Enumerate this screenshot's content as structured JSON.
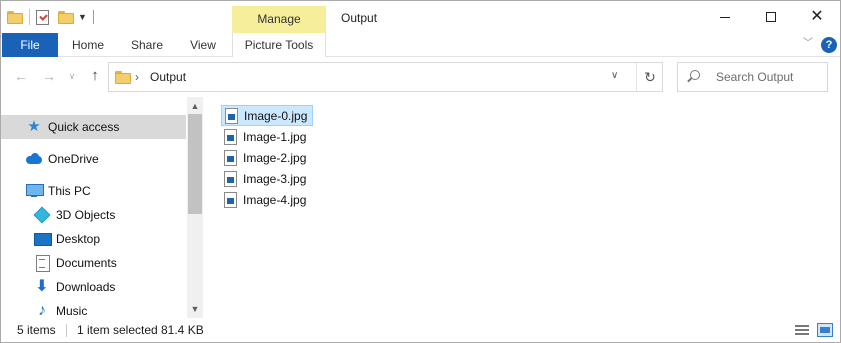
{
  "window": {
    "title": "Output",
    "contextual_tab_group": "Manage",
    "controls": [
      "minimize-icon",
      "maximize-icon",
      "close-icon"
    ]
  },
  "quick_access_toolbar": {
    "icons": [
      "folder-icon",
      "properties-icon",
      "new-folder-icon",
      "customize-dropdown-icon"
    ]
  },
  "ribbon": {
    "tabs": [
      {
        "label": "File",
        "active": true,
        "color": "#1a62b8"
      },
      {
        "label": "Home"
      },
      {
        "label": "Share"
      },
      {
        "label": "View"
      },
      {
        "label": "Picture Tools"
      }
    ],
    "help_label": "?"
  },
  "address_bar": {
    "path": "Output",
    "search_placeholder": "Search Output"
  },
  "nav_pane": {
    "items": [
      {
        "label": "Quick access",
        "icon": "star-icon",
        "selected": true
      },
      {
        "label": "OneDrive",
        "icon": "onedrive-cloud-icon"
      },
      {
        "label": "This PC",
        "icon": "computer-icon"
      },
      {
        "label": "3D Objects",
        "icon": "cube-icon"
      },
      {
        "label": "Desktop",
        "icon": "desktop-icon"
      },
      {
        "label": "Documents",
        "icon": "documents-icon"
      },
      {
        "label": "Downloads",
        "icon": "download-arrow-icon"
      },
      {
        "label": "Music",
        "icon": "music-note-icon"
      }
    ]
  },
  "files": [
    {
      "name": "Image-0.jpg",
      "selected": true
    },
    {
      "name": "Image-1.jpg"
    },
    {
      "name": "Image-2.jpg"
    },
    {
      "name": "Image-3.jpg"
    },
    {
      "name": "Image-4.jpg"
    }
  ],
  "status_bar": {
    "item_count": "5 items",
    "selection": "1 item selected",
    "size": "81.4 KB"
  },
  "colors": {
    "accent": "#1a62b8",
    "manage_highlight": "#f6ee9a",
    "selection": "#cce8ff",
    "nav_selected": "#d9d9d9"
  }
}
